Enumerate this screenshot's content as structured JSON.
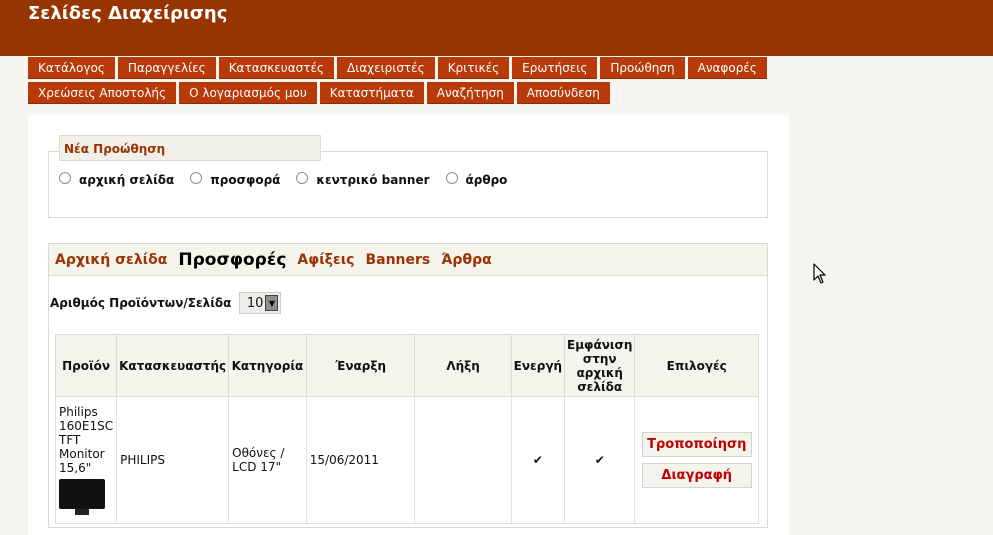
{
  "header": {
    "title": "Σελίδες Διαχείρισης"
  },
  "nav": {
    "row1": [
      "Κατάλογος",
      "Παραγγελίες",
      "Κατασκευαστές",
      "Διαχειριστές",
      "Κριτικές",
      "Ερωτήσεις",
      "Προώθηση",
      "Αναφορές"
    ],
    "row2": [
      "Χρεώσεις Αποστολής",
      "Ο λογαριασμός μου",
      "Καταστήματα",
      "Αναζήτηση",
      "Αποσύνδεση"
    ]
  },
  "new_promo": {
    "title": "Νέα Προώθηση",
    "options": [
      "αρχική σελίδα",
      "προσφορά",
      "κεντρικό banner",
      "άρθρο"
    ]
  },
  "tabs": [
    "Αρχική σελίδα",
    "Προσφορές",
    "Αφίξεις",
    "Banners",
    "Άρθρα"
  ],
  "active_tab": "Προσφορές",
  "per_page": {
    "label": "Αριθμός Προϊόντων/Σελίδα",
    "value": "10"
  },
  "table": {
    "headers": [
      "Προϊόν",
      "Κατασκευαστής",
      "Κατηγορία",
      "Έναρξη",
      "Λήξη",
      "Ενεργή",
      "Εμφάνιση στην αρχική σελίδα",
      "Επιλογές"
    ],
    "rows": [
      {
        "product": "Philips 160E1SC TFT Monitor 15,6\"",
        "manufacturer": "PHILIPS",
        "category": "Οθόνες / LCD 17\"",
        "start": "15/06/2011",
        "end": "",
        "active": "✔",
        "homepage": "✔",
        "edit_label": "Τροποποίηση",
        "delete_label": "Διαγραφή"
      }
    ]
  },
  "icons": {
    "cursor": "mouse-pointer-icon",
    "product_image": "monitor-icon",
    "select_arrow": "chevron-down-icon"
  }
}
